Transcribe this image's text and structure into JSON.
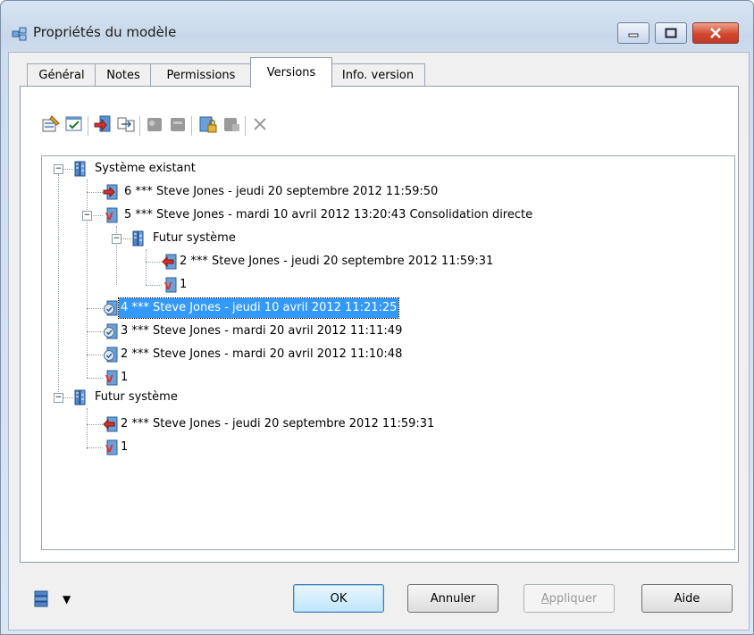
{
  "window": {
    "title": "Propriétés du modèle"
  },
  "tabs": [
    {
      "label": "Général"
    },
    {
      "label": "Notes"
    },
    {
      "label": "Permissions"
    },
    {
      "label": "Versions"
    },
    {
      "label": "Info. version"
    }
  ],
  "tree": {
    "root1": {
      "label": "Système existant"
    },
    "v6": {
      "label": "6 *** Steve Jones -  jeudi 20 septembre 2012 11:59:50"
    },
    "v5": {
      "label": "5 *** Steve Jones -  mardi 10 avril 2012 13:20:43  Consolidation directe"
    },
    "sub1": {
      "label": "Futur système"
    },
    "sub_v2": {
      "label": "2 *** Steve Jones -  jeudi 20 septembre 2012 11:59:31"
    },
    "sub_v1": {
      "label": "1"
    },
    "v4": {
      "label": "4 *** Steve Jones - jeudi 10 avril 2012  11:21:25"
    },
    "v3": {
      "label": "3 *** Steve Jones - mardi 20 avril 2012 11:11:49"
    },
    "v2": {
      "label": "2 *** Steve Jones - mardi 20 avril 2012 11:10:48"
    },
    "v1": {
      "label": "1"
    },
    "root2": {
      "label": "Futur système"
    },
    "r2_v2": {
      "label": "2 ***  Steve Jones -  jeudi 20 septembre 2012 11:59:31"
    },
    "r2_v1": {
      "label": "1"
    }
  },
  "buttons": {
    "ok": "OK",
    "cancel": "Annuler",
    "apply_first": "A",
    "apply_rest": "ppliquer",
    "help": "Aide"
  }
}
